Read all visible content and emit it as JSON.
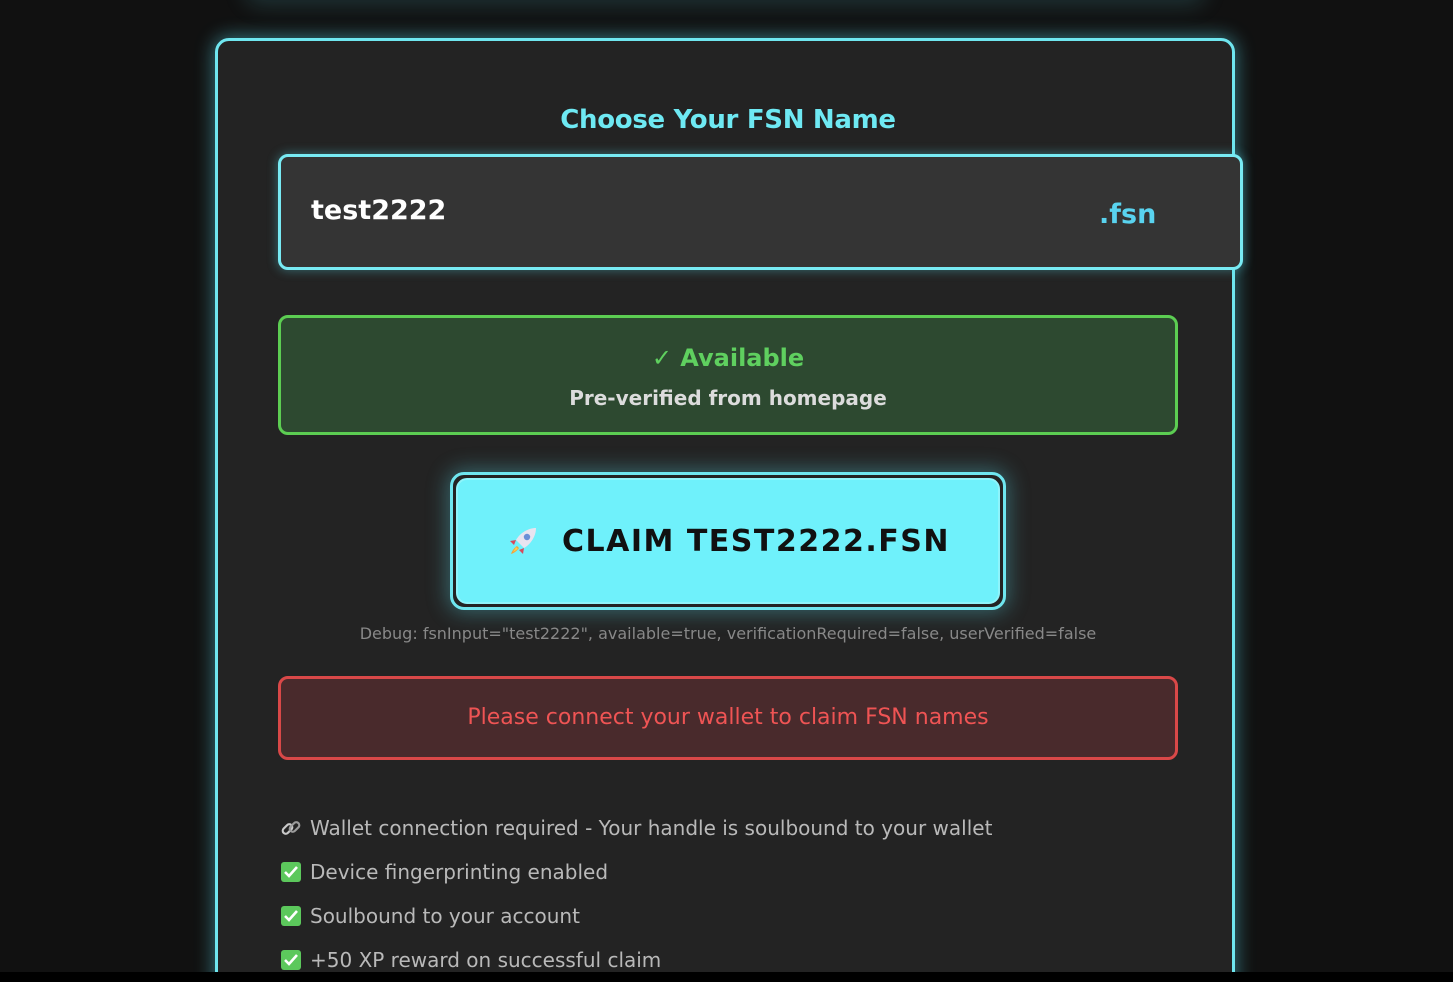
{
  "form": {
    "title": "Choose Your FSN Name",
    "name_value": "test2222",
    "suffix": ".fsn"
  },
  "status": {
    "title": "✓ Available",
    "subtitle": "Pre-verified from homepage",
    "color": "#5fd05f"
  },
  "claim": {
    "icon": "rocket-icon",
    "label": "CLAIM TEST2222.FSN",
    "color": "#6ff1fb"
  },
  "debug": {
    "text": "Debug: fsnInput=\"test2222\", available=true, verificationRequired=false, userVerified=false"
  },
  "error": {
    "text": "Please connect your wallet to claim FSN names",
    "color": "#ef5454"
  },
  "features": [
    {
      "icon": "link-icon",
      "text": "Wallet connection required - Your handle is soulbound to your wallet"
    },
    {
      "icon": "check-box-icon",
      "text": "Device fingerprinting enabled"
    },
    {
      "icon": "check-box-icon",
      "text": "Soulbound to your account"
    },
    {
      "icon": "check-box-icon",
      "text": "+50 XP reward on successful claim"
    }
  ],
  "accent": "#6ee9f3"
}
